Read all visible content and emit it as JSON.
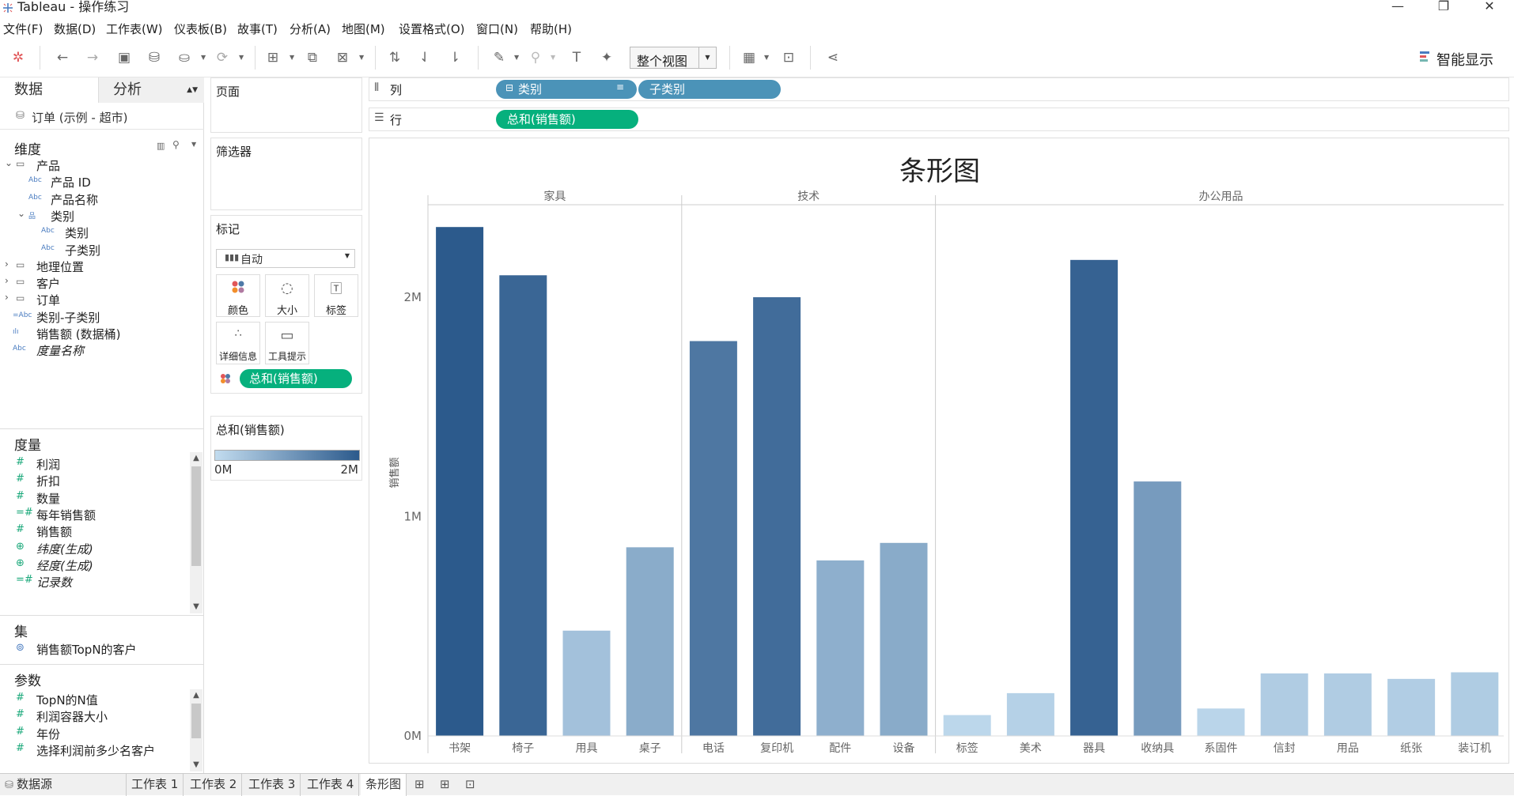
{
  "window": {
    "title": "Tableau - 操作练习",
    "minimize": "—",
    "restore": "❐",
    "close": "✕"
  },
  "menu": [
    "文件(F)",
    "数据(D)",
    "工作表(W)",
    "仪表板(B)",
    "故事(T)",
    "分析(A)",
    "地图(M)",
    "设置格式(O)",
    "窗口(N)",
    "帮助(H)"
  ],
  "toolbar": {
    "view_mode": "整个视图",
    "show_me": "智能显示"
  },
  "data_pane": {
    "tab_data": "数据",
    "tab_analysis": "分析",
    "datasource": "订单 (示例 - 超市)",
    "dimensions_title": "维度",
    "dimensions": [
      {
        "label": "产品",
        "icon": "folder-icon",
        "level": 0,
        "expand": "⌄"
      },
      {
        "label": "产品 ID",
        "icon": "abc",
        "level": 1
      },
      {
        "label": "产品名称",
        "icon": "abc",
        "level": 1
      },
      {
        "label": "类别",
        "icon": "hierarchy-icon",
        "level": 1,
        "expand": "⌄"
      },
      {
        "label": "类别",
        "icon": "abc",
        "level": 2
      },
      {
        "label": "子类别",
        "icon": "abc",
        "level": 2
      },
      {
        "label": "地理位置",
        "icon": "folder-icon",
        "level": 0,
        "expand": "›"
      },
      {
        "label": "客户",
        "icon": "folder-icon",
        "level": 0,
        "expand": "›"
      },
      {
        "label": "订单",
        "icon": "folder-icon",
        "level": 0,
        "expand": "›"
      },
      {
        "label": "类别-子类别",
        "icon": "abc-combined",
        "level": 0
      },
      {
        "label": "销售额 (数据桶)",
        "icon": "bins-icon",
        "level": 0
      },
      {
        "label": "度量名称",
        "icon": "abc",
        "level": 0,
        "italic": true
      }
    ],
    "measures_title": "度量",
    "measures": [
      {
        "label": "利润",
        "icon": "#"
      },
      {
        "label": "折扣",
        "icon": "#"
      },
      {
        "label": "数量",
        "icon": "#"
      },
      {
        "label": "每年销售额",
        "icon": "=#"
      },
      {
        "label": "销售额",
        "icon": "#"
      },
      {
        "label": "纬度(生成)",
        "icon": "⊕",
        "italic": true
      },
      {
        "label": "经度(生成)",
        "icon": "⊕",
        "italic": true
      },
      {
        "label": "记录数",
        "icon": "=#",
        "italic": true
      }
    ],
    "sets_title": "集",
    "sets": [
      {
        "label": "销售额TopN的客户"
      }
    ],
    "params_title": "参数",
    "params": [
      {
        "label": "TopN的N值",
        "icon": "#"
      },
      {
        "label": "利润容器大小",
        "icon": "#"
      },
      {
        "label": "年份",
        "icon": "#"
      },
      {
        "label": "选择利润前多少名客户",
        "icon": "#"
      }
    ]
  },
  "cards": {
    "pages": "页面",
    "filters": "筛选器",
    "marks": "标记",
    "marks_type": "自动",
    "mark_buttons": {
      "color": "颜色",
      "size": "大小",
      "label": "标签",
      "detail": "详细信息",
      "tooltip": "工具提示"
    },
    "color_pill": "总和(销售额)",
    "legend_title": "总和(销售额)",
    "legend_min": "0M",
    "legend_max": "2M",
    "legend_colors": [
      "#c2dcef",
      "#2c5a8c"
    ]
  },
  "shelves": {
    "columns_label": "列",
    "rows_label": "行",
    "col_pill_1": "类别",
    "col_pill_2": "子类别",
    "row_pill": "总和(销售额)"
  },
  "chart_data": {
    "type": "bar",
    "title": "条形图",
    "ylabel": "销售额",
    "ylim": [
      0,
      2400000
    ],
    "y_ticks": [
      "0M",
      "1M",
      "2M"
    ],
    "y_tick_values": [
      0,
      1000000,
      2000000
    ],
    "panes": [
      {
        "name": "家具",
        "categories": [
          "书架",
          "椅子",
          "用具",
          "桌子"
        ],
        "values": [
          2320000,
          2100000,
          480000,
          860000
        ]
      },
      {
        "name": "技术",
        "categories": [
          "电话",
          "复印机",
          "配件",
          "设备"
        ],
        "values": [
          1800000,
          2000000,
          800000,
          880000
        ]
      },
      {
        "name": "办公用品",
        "categories": [
          "标签",
          "美术",
          "器具",
          "收纳具",
          "系固件",
          "信封",
          "用品",
          "纸张",
          "装订机"
        ],
        "values": [
          95000,
          195000,
          2170000,
          1160000,
          125000,
          285000,
          285000,
          260000,
          290000
        ]
      }
    ]
  },
  "bottom_tabs": {
    "datasource": "数据源",
    "sheets": [
      "工作表 1",
      "工作表 2",
      "工作表 3",
      "工作表 4",
      "条形图"
    ],
    "active": "条形图"
  }
}
